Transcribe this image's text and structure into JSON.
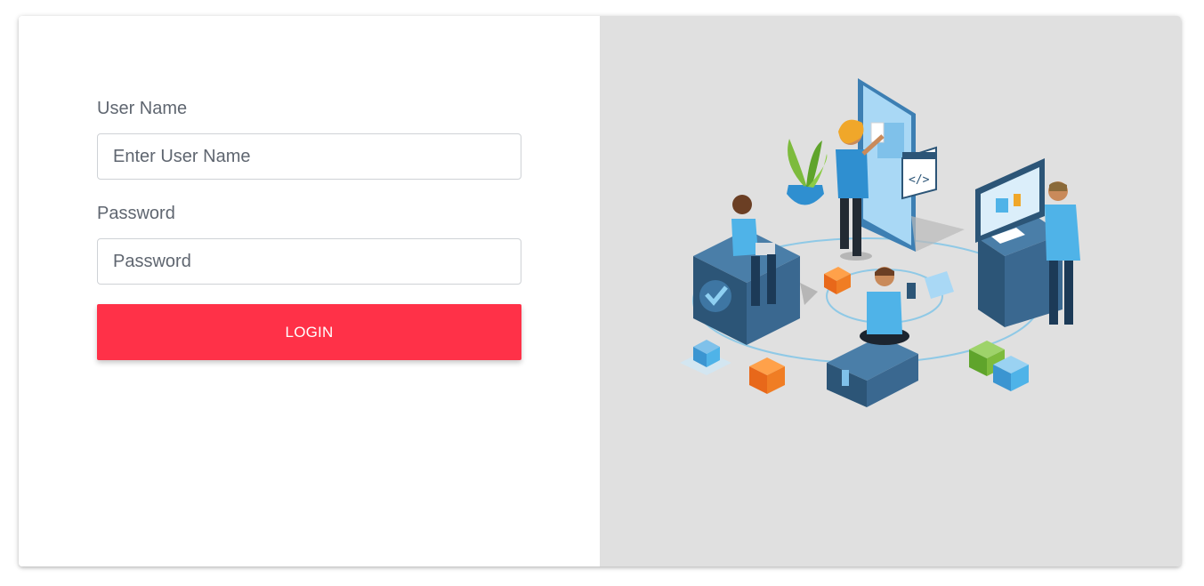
{
  "form": {
    "username_label": "User Name",
    "username_placeholder": "Enter User Name",
    "username_value": "",
    "password_label": "Password",
    "password_placeholder": "Password",
    "password_value": "",
    "login_label": "LOGIN"
  },
  "illustration": {
    "code_tag": "</>",
    "icon": "team-collaboration-illustration"
  },
  "colors": {
    "accent": "#ff3148",
    "panel_bg": "#e0e0e0",
    "label": "#5f6670",
    "illustration_blue": "#4fb3e8",
    "illustration_dark": "#2c5577"
  }
}
